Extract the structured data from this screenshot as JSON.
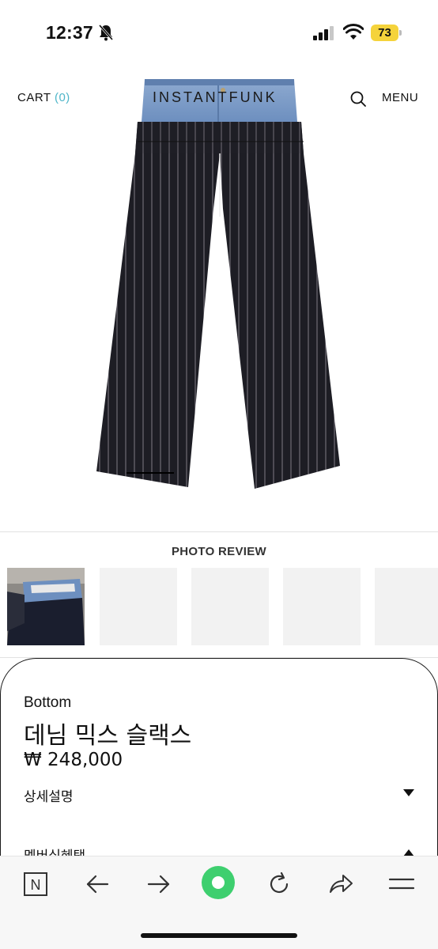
{
  "status_bar": {
    "time": "12:37",
    "battery": "73",
    "battery_color": "#f5d33b"
  },
  "header": {
    "cart_label": "CART",
    "cart_count": "(0)",
    "brand": "INSTANTFUNK",
    "menu_label": "MENU",
    "accent_color": "#4fb6c9"
  },
  "photo_review": {
    "title": "PHOTO REVIEW"
  },
  "product": {
    "category": "Bottom",
    "name": "데님 믹스 슬랙스",
    "price": "₩ 248,000",
    "sections": [
      "상세설명",
      "멤버십혜택"
    ]
  },
  "toolbar": {
    "icons": [
      "naver-icon",
      "back-arrow-icon",
      "forward-arrow-icon",
      "green-home-icon",
      "refresh-icon",
      "share-icon",
      "hamburger-menu-icon"
    ],
    "naver_letter": "N",
    "home_color": "#3ecf6f"
  }
}
